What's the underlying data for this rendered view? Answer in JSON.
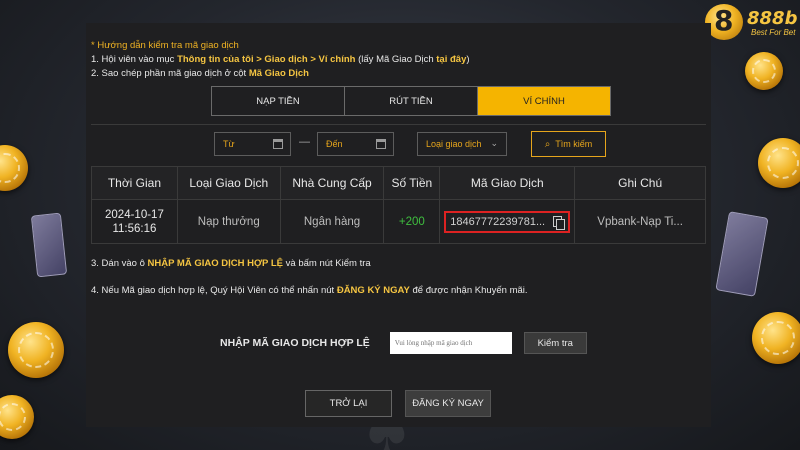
{
  "brand": {
    "mark": "8",
    "name": "888b",
    "tagline": "Best For Bet",
    "accent": "#f5c542"
  },
  "guide": {
    "title": "* Hướng dẫn kiểm tra mã giao dịch",
    "line1_prefix": "1. Hội viên vào mục ",
    "line1_highlight": "Thông tin của tôi > Giao dịch > Ví chính",
    "line1_mid": " (lấy Mã Giao Dịch ",
    "line1_link": "tại đây",
    "line1_suffix": ")",
    "line2_prefix": "2. Sao chép phần mã giao dịch ở cột ",
    "line2_highlight": "Mã Giao Dịch"
  },
  "tabs": [
    {
      "label": "NẠP TIỀN",
      "active": false
    },
    {
      "label": "RÚT TIỀN",
      "active": false
    },
    {
      "label": "VÍ CHÍNH",
      "active": true
    }
  ],
  "filters": {
    "from_placeholder": "Từ",
    "to_placeholder": "Đến",
    "type_placeholder": "Loại giao dịch",
    "search_label": "Tìm kiếm"
  },
  "table": {
    "headers": [
      "Thời Gian",
      "Loại Giao Dịch",
      "Nhà Cung Cấp",
      "Số Tiền",
      "Mã Giao Dịch",
      "Ghi Chú"
    ],
    "rows": [
      {
        "date": "2024-10-17",
        "time": "11:56:16",
        "type": "Nạp thưởng",
        "provider": "Ngân hàng",
        "amount": "+200",
        "txn_code": "18467772239781...",
        "note": "Vpbank-Nạp Ti..."
      }
    ]
  },
  "step3": {
    "prefix": "3. Dán vào ô ",
    "highlight": "NHẬP MÃ GIAO DỊCH HỢP LỆ",
    "suffix": " và bấm nút Kiểm tra"
  },
  "step4": {
    "prefix": "4. Nếu Mã giao dịch hợp lệ, Quý Hội Viên có thể nhấn nút ",
    "highlight": "ĐĂNG KÝ NGAY",
    "suffix": " để được nhận Khuyến mãi."
  },
  "check": {
    "label": "NHẬP MÃ GIAO DỊCH HỢP LỆ",
    "placeholder": "Vui lòng nhập mã giao dịch",
    "button": "Kiểm tra"
  },
  "actions": {
    "back": "TRỞ LẠI",
    "register": "ĐĂNG KÝ NGAY"
  },
  "colors": {
    "highlight": "#f5c542",
    "active_tab": "#f5b400",
    "amount_positive": "#3fbf3f",
    "txn_box_border": "#dd2222"
  }
}
